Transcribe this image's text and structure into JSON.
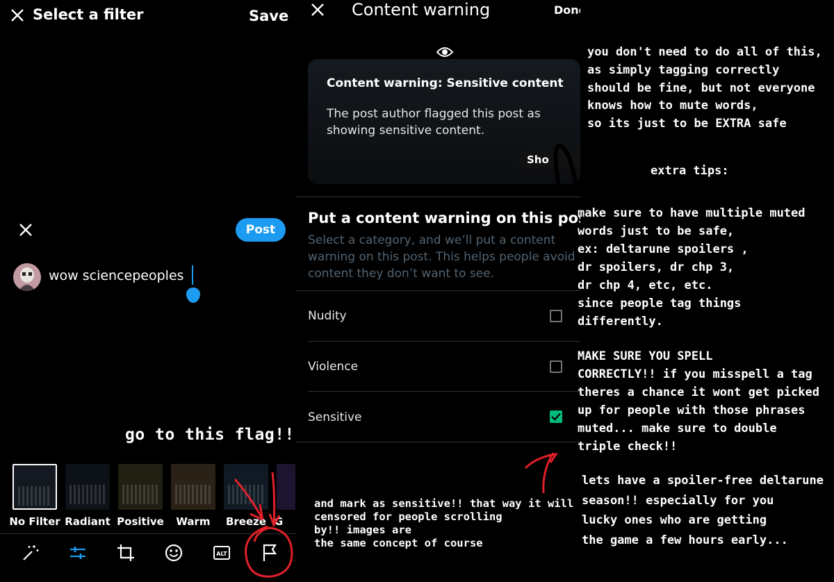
{
  "left": {
    "header": {
      "title": "Select a filter",
      "save_label": "Save"
    },
    "composer": {
      "post_label": "Post",
      "text": "wow sciencepeoples"
    },
    "annotation": "go to this flag!!",
    "filters": [
      "No Filter",
      "Radiant",
      "Positive",
      "Warm",
      "Breeze",
      "G"
    ],
    "toolbar_icons": [
      "magic-wand-icon",
      "sliders-icon",
      "crop-icon",
      "emoji-icon",
      "alt-text-icon",
      "flag-icon"
    ]
  },
  "middle": {
    "header": {
      "title": "Content warning",
      "done_label": "Done"
    },
    "preview": {
      "title": "Content warning: Sensitive content",
      "body": "The post author flagged this post as showing sensitive content.",
      "show_label": "Sho"
    },
    "section": {
      "title": "Put a content warning on this pos",
      "description": "Select a category, and we’ll put a content warning on this post. This helps people avoid content they don’t want to see."
    },
    "categories": [
      {
        "label": "Nudity",
        "checked": false
      },
      {
        "label": "Violence",
        "checked": false
      },
      {
        "label": "Sensitive",
        "checked": true
      }
    ],
    "annotation": "and mark as sensitive!! that way it will be\ncensored for people scrolling\nby!! images are\nthe same concept of course"
  },
  "right": {
    "note1": "you don't need to do all of this,\nas simply tagging correctly\nshould be fine, but not everyone\nknows how to mute words,\nso its just to be EXTRA safe",
    "tips_heading": "extra tips:",
    "note2": "make sure to have multiple muted\nwords just to be safe,\nex: deltarune spoilers ,\ndr spoilers, dr chp 3,\ndr chp 4, etc, etc.\nsince people tag things\ndifferently.",
    "note3": "MAKE SURE YOU SPELL\nCORRECTLY!! if you misspell a tag\ntheres a chance it wont get picked\nup for people with those phrases\nmuted... make sure to double\ntriple check!!",
    "note4": "lets have a spoiler-free deltarune\nseason!! especially for you\nlucky ones who are getting\nthe game a few hours early..."
  },
  "colors": {
    "accent": "#1d9bf0",
    "check": "#00ba7c",
    "annotation_red": "#e1202a"
  }
}
